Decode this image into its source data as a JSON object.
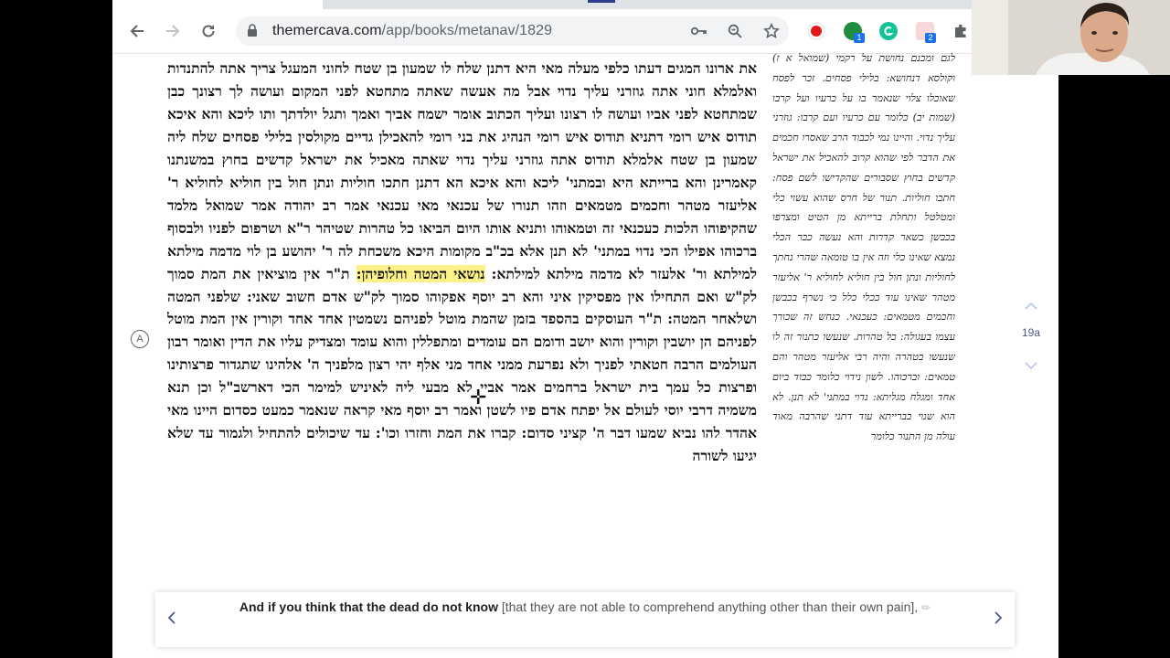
{
  "browser": {
    "url_host": "themercava.com",
    "url_path": "/app/books/metanav/1829",
    "extension_badges": [
      "1",
      "2"
    ]
  },
  "colors": {
    "highlight": "#fdf28a",
    "nav_arrow": "#b9c6e4",
    "translation_arrow": "#4b5a8f"
  },
  "reader": {
    "main_text_before": "את ארונו המגים דעתו כלפי מעלה מאי היא דתנן שלח לו שמעון בן שטח לחוני המעגל צריך אתה להתנדות ואלמלא חוני אתה גוזרני עליך נדוי אבל מה אעשה שאתה מתחטא לפני המקום ועושה לך רצונך כבן שמתחטא לפני אביו ועושה לו רצונו ועליך הכתוב אומר ישמח אביך ואמך ותגל יולדתך ותו ליכא והא איכא תודוס איש רומי דתניא תודוס איש רומי הנהיג את בני רומי להאכילן גדיים מקולסין בלילי פסחים שלח ליה שמעון בן שטח אלמלא תודוס אתה גוזרני עליך נדוי שאתה מאכיל את ישראל קדשים בחוץ במשנתנו קאמרינן והא ברייתא היא ובמתני' ליכא והא איכא הא דתנן חתכו חוליות ונתן חול בין חוליא לחוליא ר' אליעזר מטהר וחכמים מטמאים וזהו תנורו של עכנאי מאי עכנאי אמר רב יהודה אמר שמואל מלמד שהקיפוהו הלכות כעכנאי זה וטמאוהו ותניא אותו היום הביאו כל טהרות שטיהר ר\"א ושרפום לפניו ולבסוף ברכוהו אפילו הכי נדוי במתני' לא תנן אלא בכ\"ב מקומות היכא משכחת לה ר' יהושע בן לוי מדמה מילתא למילתא ור' אלעזר לא מדמה מילתא למילתא:",
    "main_text_highlight": "נושאי המטה וחלופיהן:",
    "main_text_after": "ת\"ר אין מוציאין את המת סמוך לק\"ש ואם התחילו אין מפסיקין איני והא רב יוסף אפקוהו סמוך לק\"ש אדם חשוב שאני: שלפני המטה ושלאחר המטה: ת\"ר העוסקים בהספד בזמן שהמת מוטל לפניהם נשמטין אחד אחד וקורין אין המת מוטל לפניהם הן יושבין וקורין והוא יושב ודומם הם עומדים ומתפללין והוא עומד ומצדיק עליו את הדין ואומר רבון העולמים הרבה חטאתי לפניך ולא נפרעת ממני אחד מני אלף יהי רצון מלפניך ה' אלהינו שתגדור פרצותינו ופרצות כל עמך בית ישראל ברחמים אמר אביי לא מבעי ליה לאיניש למימר הכי דארשב\"ל וכן תנא משמיה דרבי יוסי לעולם אל יפתח אדם פיו לשטן ואמר רב יוסף מאי קראה שנאמר כמעט כסדום היינו מאי אהדר להו נביא שמעו דבר ה' קציני סדום: קברו את המת וחזרו וכו': עד שיכולים להתחיל ולגמור עד שלא יגיעו לשורה",
    "commentary_text": "לגם ומכנם נחושת על רקמי (שמואל א ז) וקולסא דנחושא: בלילי פסחים. זכר לפסח שאוכלו צלוי שנאמר בו על כרעיו ועל קרבו (שמות יב) כלומר עם כרעיו ועם קרבו: גוזרני עליך נדוי. והיינו נמי לכבוד הרב שאסרו חכמים את הדבר לפי שהוא קרוב להאכיל את ישראל קדשים בחוץ שסבורים שהקדישו לשם פסח: חתכו חוליות. תנור של חרס שהוא עשוי כלי ומטלטל ותחלת ברייתא מן הטיט ומצרפו בכבשן כשאר קדרות והא נעשה כבר הכלי נמצא שאינו כלי וזה אין בו טומאה שהרי נחתך לחוליות ונתן חול בין חוליא לחוליא ר' אליעזר מטהר שאינו עוד ככלי כלל כי נשרף בכבשן וחכמים מטמאים: כעכנאי. כנחש זה שכורך עצמו בעגולה: כל טהרות. שנעשו כתנור זה לו שנעשו בטהרה והיה רבי אליעזר מטהר והם טמאים: וברכוהו. לשון נידוי כלומר כבוד ביום אחד ומגלח מגליתא: נדוי במתני' לא תנן. לא הוא שנוי בברייתא עוד דתני שהרבה מאוד עולה מן התנור כלומר ",
    "page_number": "19a"
  },
  "translation": {
    "bold_text": "And if you think that the dead do not know",
    "bracket_text": "[that they are not able to comprehend anything other than their own pain],",
    "edit_glyph": "✏"
  }
}
